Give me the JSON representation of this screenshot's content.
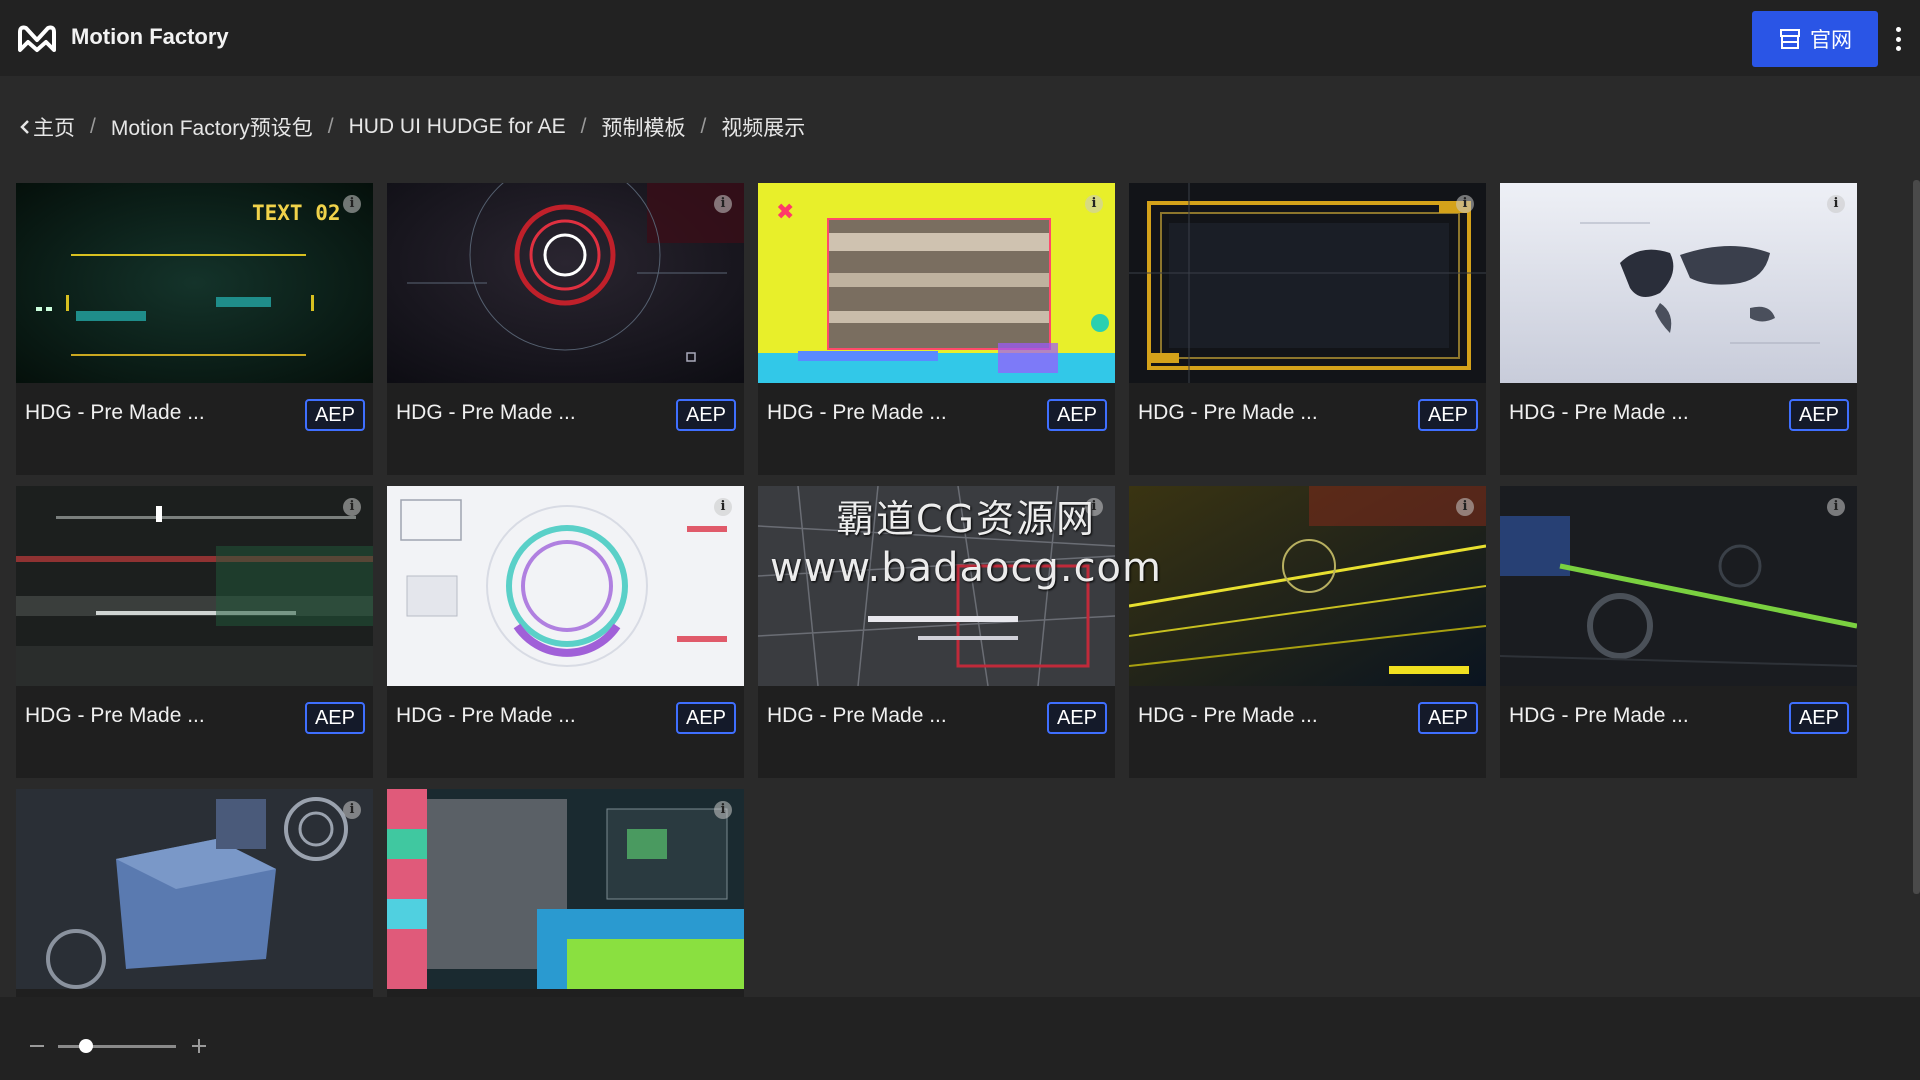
{
  "header": {
    "app_title": "Motion Factory",
    "site_button_label": "官网",
    "logo_icon": "mf-logo-icon",
    "more_icon": "more-vertical-icon"
  },
  "breadcrumb": [
    "主页",
    "Motion Factory预设包",
    "HUD UI HUDGE for AE",
    "预制模板",
    "视频展示"
  ],
  "cards": [
    {
      "title": "HDG - Pre Made ...",
      "badge": "AEP",
      "thumb_text": "TEXT 02"
    },
    {
      "title": "HDG - Pre Made ...",
      "badge": "AEP"
    },
    {
      "title": "HDG - Pre Made ...",
      "badge": "AEP"
    },
    {
      "title": "HDG - Pre Made ...",
      "badge": "AEP"
    },
    {
      "title": "HDG - Pre Made ...",
      "badge": "AEP"
    },
    {
      "title": "HDG - Pre Made ...",
      "badge": "AEP"
    },
    {
      "title": "HDG - Pre Made ...",
      "badge": "AEP"
    },
    {
      "title": "HDG - Pre Made ...",
      "badge": "AEP"
    },
    {
      "title": "HDG - Pre Made ...",
      "badge": "AEP"
    },
    {
      "title": "HDG - Pre Made ...",
      "badge": "AEP"
    },
    {
      "title": "",
      "badge": ""
    },
    {
      "title": "",
      "badge": ""
    }
  ],
  "watermark": {
    "line1": "霸道CG资源网",
    "line2": "www.badaocg.com"
  },
  "colors": {
    "accent": "#2a55e6",
    "badge_border": "#3f6fff",
    "background": "#2a2a2a",
    "card": "#1f1f1f"
  },
  "zoom": {
    "level": 0.2
  }
}
